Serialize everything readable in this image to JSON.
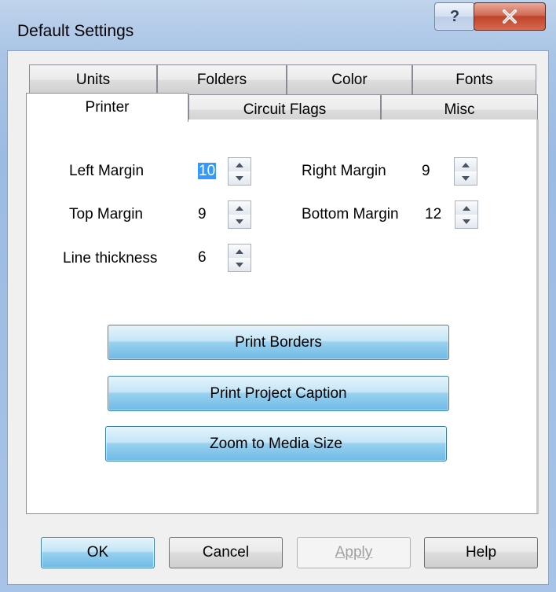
{
  "window": {
    "title": "Default Settings"
  },
  "titlebar": {
    "help_label": "?"
  },
  "tabs_back": [
    {
      "label": "Units"
    },
    {
      "label": "Folders"
    },
    {
      "label": "Color"
    },
    {
      "label": "Fonts"
    }
  ],
  "tabs_front": [
    {
      "label": "Printer",
      "active": true
    },
    {
      "label": "Circuit Flags"
    },
    {
      "label": "Misc"
    }
  ],
  "form": {
    "left_margin": {
      "label": "Left Margin",
      "value": "10"
    },
    "right_margin": {
      "label": "Right Margin",
      "value": "9"
    },
    "top_margin": {
      "label": "Top Margin",
      "value": "9"
    },
    "bottom_margin": {
      "label": "Bottom Margin",
      "value": "12"
    },
    "line_thickness": {
      "label": "Line thickness",
      "value": "6"
    }
  },
  "actions": {
    "print_borders": "Print Borders",
    "print_project_caption": "Print Project Caption",
    "zoom_to_media_size": "Zoom to Media Size"
  },
  "footer": {
    "ok": "OK",
    "cancel": "Cancel",
    "apply": "Apply",
    "help": "Help"
  },
  "colors": {
    "selection": "#3399ff",
    "close_button": "#c0432a",
    "accent_button": "#98d1ef"
  }
}
